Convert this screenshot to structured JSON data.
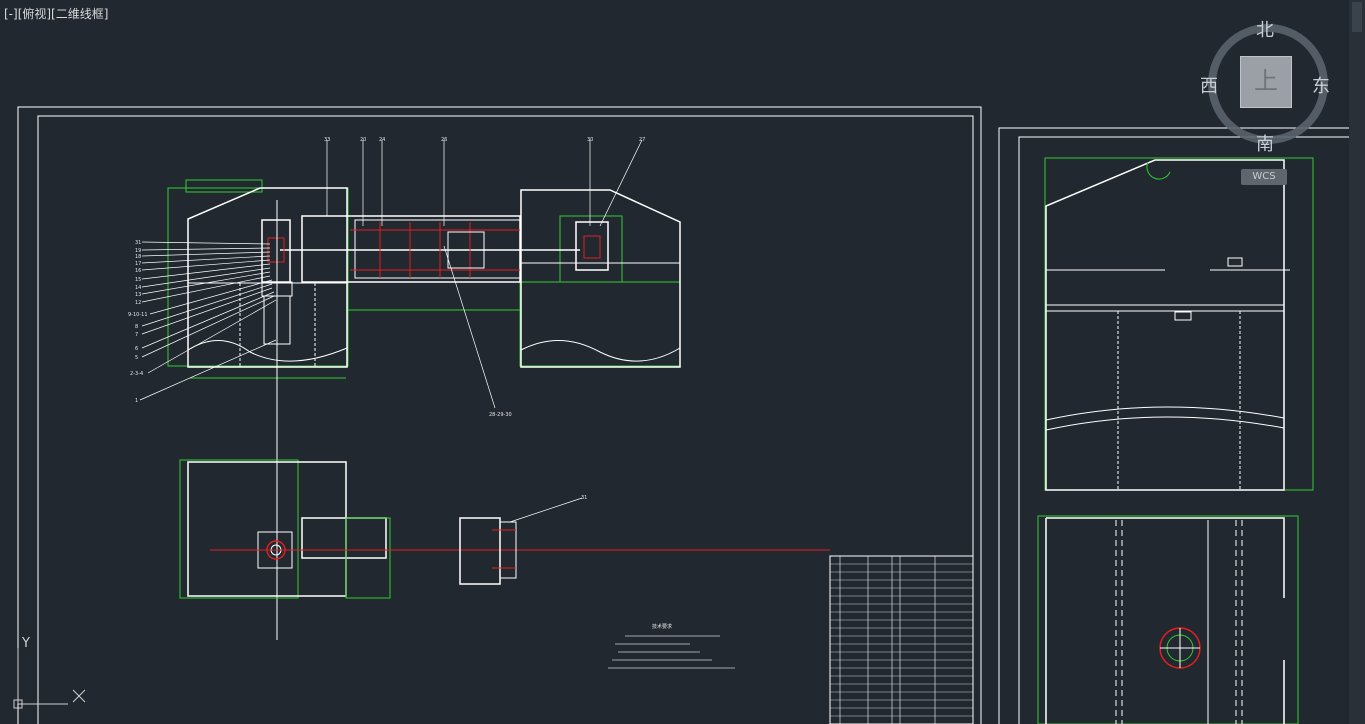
{
  "viewport": {
    "label": "[-][俯视][二维线框]"
  },
  "viewcube": {
    "north": "北",
    "south": "南",
    "east": "东",
    "west": "西",
    "face": "上",
    "wcs": "WCS"
  },
  "ucs": {
    "y_label": "Y"
  },
  "drawing": {
    "callouts_top": [
      "33",
      "20",
      "24",
      "26",
      "30",
      "27"
    ],
    "callouts_left": [
      "31",
      "19",
      "18",
      "17",
      "16",
      "15",
      "14",
      "13",
      "12",
      "9-10-11",
      "8",
      "7",
      "6",
      "5",
      "2-3-4",
      "1"
    ],
    "callout_center": "28-29-30",
    "callout_right": "31",
    "tech_notes_title": "技术要求",
    "colors": {
      "background": "#212830",
      "white": "#ffffff",
      "green": "#33cc33",
      "red": "#e02020"
    }
  }
}
